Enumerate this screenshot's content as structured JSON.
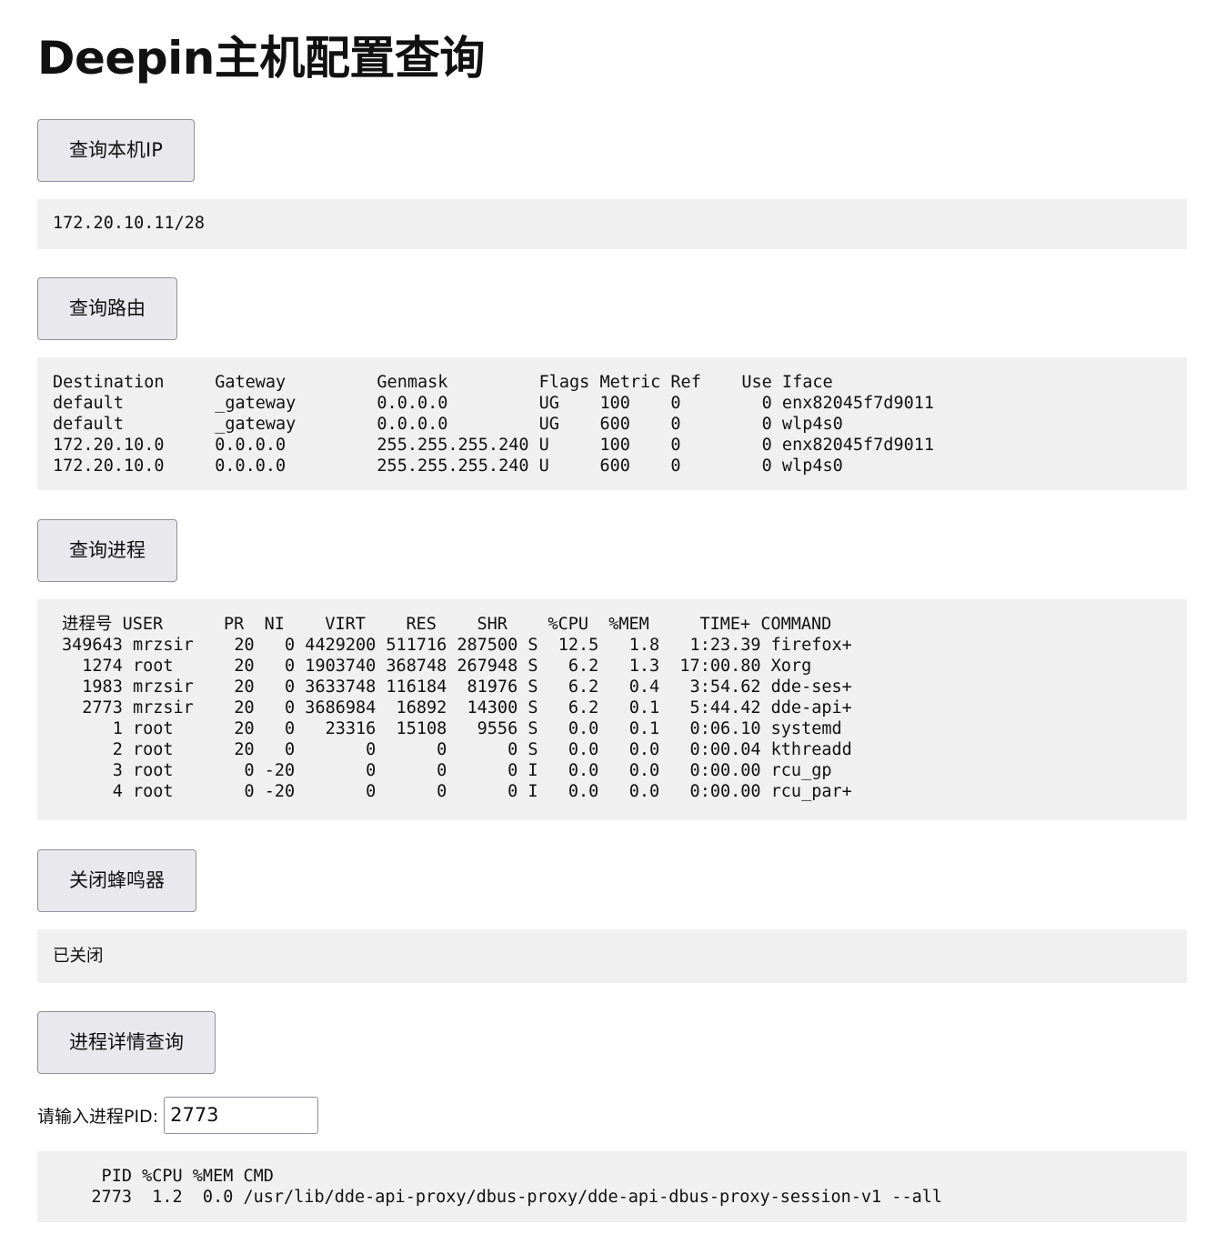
{
  "page": {
    "title": "Deepin主机配置查询"
  },
  "sections": {
    "ip": {
      "button_label": "查询本机IP",
      "output": "172.20.10.11/28"
    },
    "route": {
      "button_label": "查询路由",
      "output": "Destination     Gateway         Genmask         Flags Metric Ref    Use Iface\ndefault         _gateway        0.0.0.0         UG    100    0        0 enx82045f7d9011\ndefault         _gateway        0.0.0.0         UG    600    0        0 wlp4s0\n172.20.10.0     0.0.0.0         255.255.255.240 U     100    0        0 enx82045f7d9011\n172.20.10.0     0.0.0.0         255.255.255.240 U     600    0        0 wlp4s0"
    },
    "process": {
      "button_label": "查询进程",
      "output": "进程号 USER      PR  NI    VIRT    RES    SHR    %CPU  %MEM     TIME+ COMMAND\n349643 mrzsir    20   0 4429200 511716 287500 S  12.5   1.8   1:23.39 firefox+\n  1274 root      20   0 1903740 368748 267948 S   6.2   1.3  17:00.80 Xorg\n  1983 mrzsir    20   0 3633748 116184  81976 S   6.2   0.4   3:54.62 dde-ses+\n  2773 mrzsir    20   0 3686984  16892  14300 S   6.2   0.1   5:44.42 dde-api+\n     1 root      20   0   23316  15108   9556 S   0.0   0.1   0:06.10 systemd\n     2 root      20   0       0      0      0 S   0.0   0.0   0:00.04 kthreadd\n     3 root       0 -20       0      0      0 I   0.0   0.0   0:00.00 rcu_gp\n     4 root       0 -20       0      0      0 I   0.0   0.0   0:00.00 rcu_par+"
    },
    "buzzer": {
      "button_label": "关闭蜂鸣器",
      "output": "已关闭"
    },
    "detail": {
      "button_label": "进程详情查询",
      "pid_label": "请输入进程PID:",
      "pid_value": "2773",
      "output": "    PID %CPU %MEM CMD\n   2773  1.2  0.0 /usr/lib/dde-api-proxy/dbus-proxy/dde-api-dbus-proxy-session-v1 --all"
    }
  }
}
